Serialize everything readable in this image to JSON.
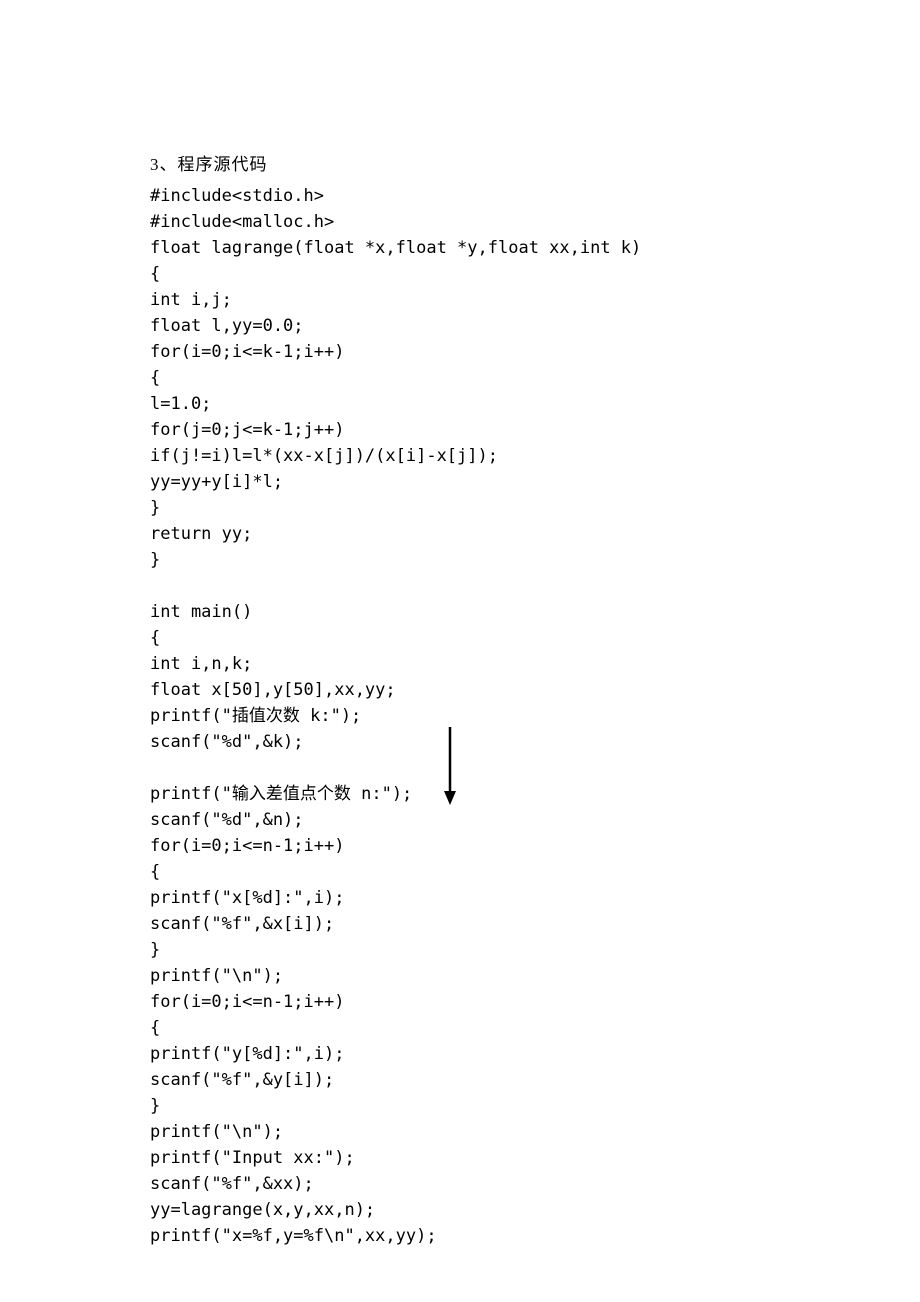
{
  "heading": "3、程序源代码",
  "code": "#include<stdio.h>\n#include<malloc.h>\nfloat lagrange(float *x,float *y,float xx,int k)\n{\nint i,j;\nfloat l,yy=0.0;\nfor(i=0;i<=k-1;i++)\n{\nl=1.0;\nfor(j=0;j<=k-1;j++)\nif(j!=i)l=l*(xx-x[j])/(x[i]-x[j]);\nyy=yy+y[i]*l;\n}\nreturn yy;\n}\n\nint main()\n{\nint i,n,k;\nfloat x[50],y[50],xx,yy;\nprintf(\"插值次数 k:\");\nscanf(\"%d\",&k);\n\nprintf(\"输入差值点个数 n:\");\nscanf(\"%d\",&n);\nfor(i=0;i<=n-1;i++)\n{\nprintf(\"x[%d]:\",i);\nscanf(\"%f\",&x[i]);\n}\nprintf(\"\\n\");\nfor(i=0;i<=n-1;i++)\n{\nprintf(\"y[%d]:\",i);\nscanf(\"%f\",&y[i]);\n}\nprintf(\"\\n\");\nprintf(\"Input xx:\");\nscanf(\"%f\",&xx);\nyy=lagrange(x,y,xx,n);\nprintf(\"x=%f,y=%f\\n\",xx,yy);"
}
